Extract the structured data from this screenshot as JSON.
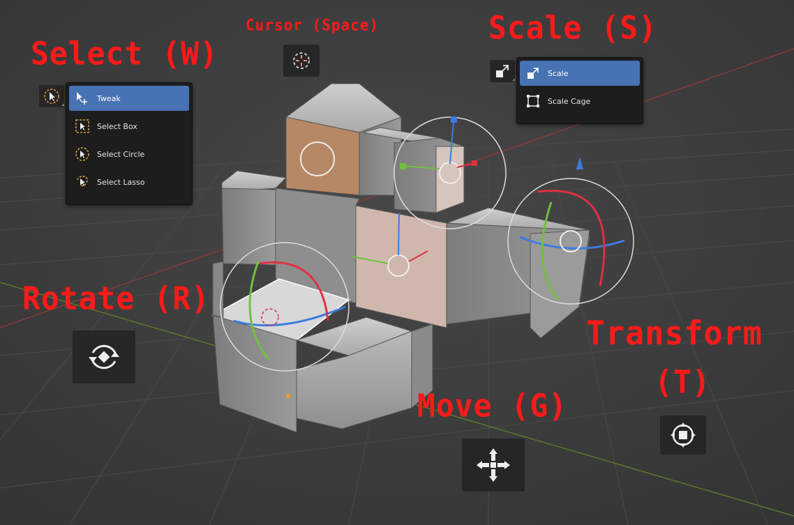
{
  "labels": {
    "cursor": "Cursor (Space)",
    "select": "Select (W)",
    "scale": "Scale (S)",
    "rotate": "Rotate (R)",
    "transform_line1": "Transform",
    "transform_line2": "(T)",
    "move": "Move (G)"
  },
  "select_menu": {
    "items": [
      {
        "label": "Tweak",
        "icon": "tweak-icon",
        "active": true
      },
      {
        "label": "Select Box",
        "icon": "select-box-icon",
        "active": false
      },
      {
        "label": "Select Circle",
        "icon": "select-circle-icon",
        "active": false
      },
      {
        "label": "Select Lasso",
        "icon": "select-lasso-icon",
        "active": false
      }
    ]
  },
  "scale_menu": {
    "items": [
      {
        "label": "Scale",
        "icon": "scale-icon",
        "active": true
      },
      {
        "label": "Scale Cage",
        "icon": "scale-cage-icon",
        "active": false
      }
    ]
  },
  "colors": {
    "label_red": "#ff1a1a",
    "menu_active": "#4772b3",
    "axis_x": "#e03040",
    "axis_y": "#70c040",
    "axis_z": "#3a7be0"
  }
}
